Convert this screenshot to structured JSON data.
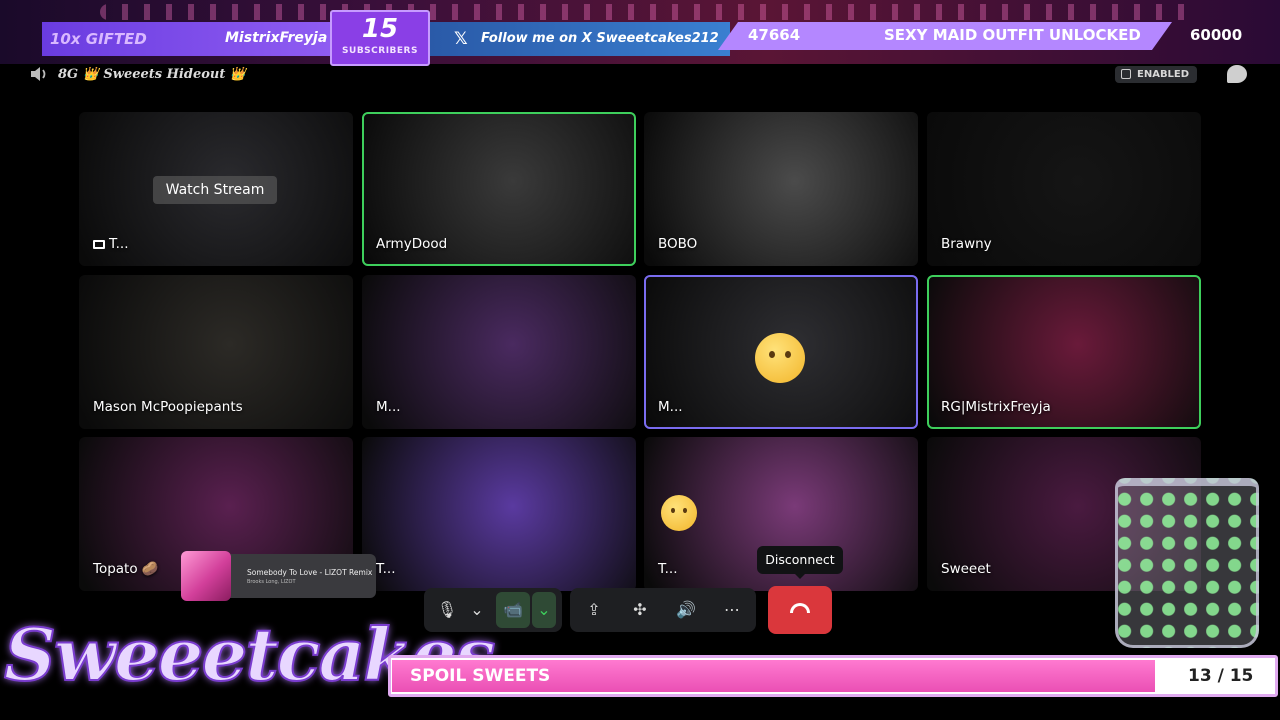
{
  "banner": {
    "gifted_count": "10x GIFTED",
    "gifted_name": "MistrixFreyja",
    "subs_count": "15",
    "subs_label": "SUBSCRIBERS",
    "follow_icon": "x-logo-icon",
    "follow_text": "Follow me on X Sweeetcakes212",
    "goal_current": "47664",
    "goal_text": "SEXY MAID OUTFIT UNLOCKED",
    "goal_max": "60000"
  },
  "server": {
    "name": "8G 👑 Sweeets Hideout 👑",
    "enabled_label": "ENABLED"
  },
  "tiles": [
    {
      "label": "T...",
      "type": "stream",
      "watch_label": "Watch Stream",
      "bg": "#2a2a2e",
      "state": "none"
    },
    {
      "label": "ArmyDood",
      "bg": "#3a3a3a",
      "state": "speaking"
    },
    {
      "label": "BOBO",
      "bg": "#4b4b4b",
      "state": "none"
    },
    {
      "label": "Brawny",
      "bg": "#151515",
      "state": "none"
    },
    {
      "label": "Mason McPoopiepants",
      "bg": "#2c2a26",
      "state": "none"
    },
    {
      "label": "M...",
      "bg": "#4a2a60",
      "state": "none"
    },
    {
      "label": "M...",
      "bg": "#2e2e32",
      "state": "selected"
    },
    {
      "label": "RG|MistrixFreyja",
      "bg": "#6a1a3a",
      "state": "speaking"
    },
    {
      "label": "Topato 🥔",
      "bg": "#5a2050",
      "state": "none"
    },
    {
      "label": "T...",
      "bg": "#5a3aa0",
      "state": "none"
    },
    {
      "label": "T...",
      "bg": "#7a3a78",
      "state": "none"
    },
    {
      "label": "Sweeet",
      "bg": "#4a1a40",
      "state": "none"
    }
  ],
  "music": {
    "title": "Somebody To Love - LIZOT Remix",
    "artist": "Brooks Long, LIZOT"
  },
  "controls": {
    "disconnect_tooltip": "Disconnect",
    "mic_icon": "🎙",
    "chevron": "⌄",
    "camera_icon": "📹",
    "share_icon": "⇪",
    "activity_icon": "✣",
    "soundboard_icon": "🔊",
    "more_icon": "⋯"
  },
  "footer": {
    "logo_text": "Sweeetcakes",
    "progress_label": "SPOIL SWEETS",
    "progress_count": "13 / 15",
    "progress_fraction": 0.8667
  },
  "colors": {
    "speaking": "#3ecf5c",
    "selected": "#7a6cf0",
    "disconnect": "#da373c",
    "progress": "#ea4fb4"
  }
}
